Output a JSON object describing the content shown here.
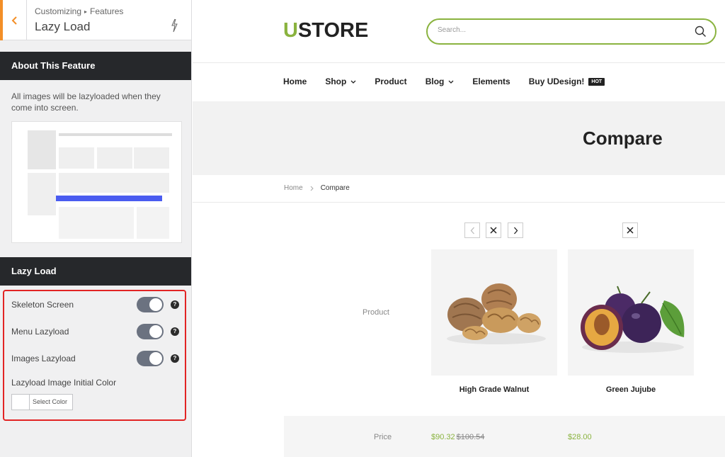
{
  "panel": {
    "breadcrumb": [
      "Customizing",
      "Features"
    ],
    "title": "Lazy Load",
    "about_heading": "About This Feature",
    "about_text": "All images will be lazyloaded when they come into screen.",
    "section_heading": "Lazy Load",
    "options": [
      {
        "label": "Skeleton Screen",
        "enabled": true
      },
      {
        "label": "Menu Lazyload",
        "enabled": true
      },
      {
        "label": "Images Lazyload",
        "enabled": true
      }
    ],
    "help_glyph": "?",
    "color_label": "Lazyload Image Initial Color",
    "color_button": "Select Color"
  },
  "store": {
    "logo_accent": "U",
    "logo_rest": "STORE",
    "search_placeholder": "Search...",
    "nav": [
      {
        "label": "Home",
        "dropdown": false
      },
      {
        "label": "Shop",
        "dropdown": true
      },
      {
        "label": "Product",
        "dropdown": false
      },
      {
        "label": "Blog",
        "dropdown": true
      },
      {
        "label": "Elements",
        "dropdown": false
      },
      {
        "label": "Buy UDesign!",
        "dropdown": false,
        "badge": "HOT"
      }
    ],
    "page_title": "Compare",
    "breadcrumb": [
      "Home",
      "Compare"
    ],
    "row_labels": {
      "product": "Product",
      "price": "Price"
    },
    "products": [
      {
        "name": "High Grade Walnut",
        "price": "$90.32",
        "old_price": "$100.54"
      },
      {
        "name": "Green Jujube",
        "price": "$28.00",
        "old_price": ""
      }
    ]
  },
  "colors": {
    "accent": "#8ab33f",
    "panel_dark": "#26282b",
    "highlight": "#e22424",
    "back_accent": "#f38f27"
  }
}
